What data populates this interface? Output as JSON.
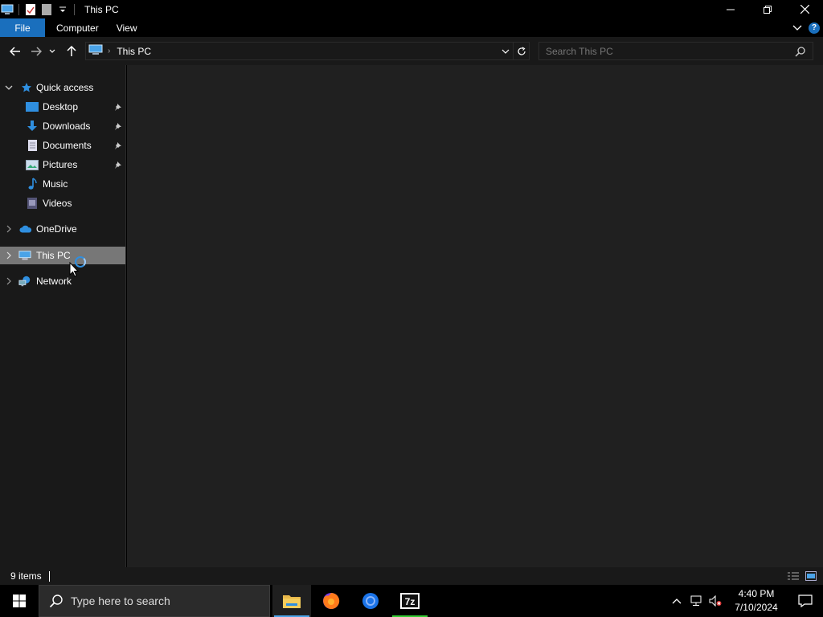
{
  "window": {
    "title": "This PC"
  },
  "ribbon": {
    "tabs": [
      "File",
      "Computer",
      "View"
    ]
  },
  "address": {
    "crumb": "This PC",
    "search_placeholder": "Search This PC"
  },
  "nav": {
    "quick_access": "Quick access",
    "items": [
      {
        "label": "Desktop",
        "icon": "desktop-icon",
        "pinned": true
      },
      {
        "label": "Downloads",
        "icon": "download-icon",
        "pinned": true
      },
      {
        "label": "Documents",
        "icon": "document-icon",
        "pinned": true
      },
      {
        "label": "Pictures",
        "icon": "pictures-icon",
        "pinned": true
      },
      {
        "label": "Music",
        "icon": "music-icon",
        "pinned": false
      },
      {
        "label": "Videos",
        "icon": "videos-icon",
        "pinned": false
      }
    ],
    "onedrive": "OneDrive",
    "this_pc": "This PC",
    "network": "Network"
  },
  "status": {
    "count": "9 items"
  },
  "taskbar": {
    "search_placeholder": "Type here to search",
    "apps": [
      "file-explorer-icon",
      "firefox-icon",
      "chrome-icon",
      "7zip-icon"
    ],
    "time": "4:40 PM",
    "date": "7/10/2024"
  },
  "colors": {
    "accent": "#1a6fbd",
    "content_bg": "#202020",
    "pane_bg": "#191919",
    "selected": "#777777"
  }
}
